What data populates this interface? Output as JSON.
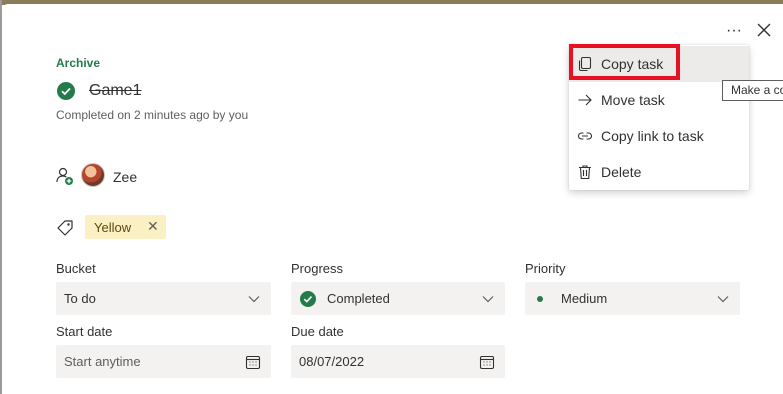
{
  "task": {
    "bucket_section": "Archive",
    "title": "Game1",
    "completed_text": "Completed on 2 minutes ago by you",
    "assignee": "Zee",
    "label": "Yellow"
  },
  "fields": {
    "bucket": {
      "label": "Bucket",
      "value": "To do"
    },
    "progress": {
      "label": "Progress",
      "value": "Completed"
    },
    "priority": {
      "label": "Priority",
      "value": "Medium"
    },
    "start_date": {
      "label": "Start date",
      "placeholder": "Start anytime"
    },
    "due_date": {
      "label": "Due date",
      "value": "08/07/2022"
    }
  },
  "header": {
    "more_label": "···"
  },
  "menu": {
    "items": [
      {
        "label": "Copy task",
        "icon": "copy-icon"
      },
      {
        "label": "Move task",
        "icon": "arrow-right-icon"
      },
      {
        "label": "Copy link to task",
        "icon": "link-icon"
      },
      {
        "label": "Delete",
        "icon": "trash-icon"
      }
    ]
  },
  "tooltip": "Make a co",
  "colors": {
    "accent_green": "#237b4b",
    "label_yellow": "#fbf0c4",
    "highlight_red": "#e81123",
    "field_bg": "#f3f2f1"
  }
}
